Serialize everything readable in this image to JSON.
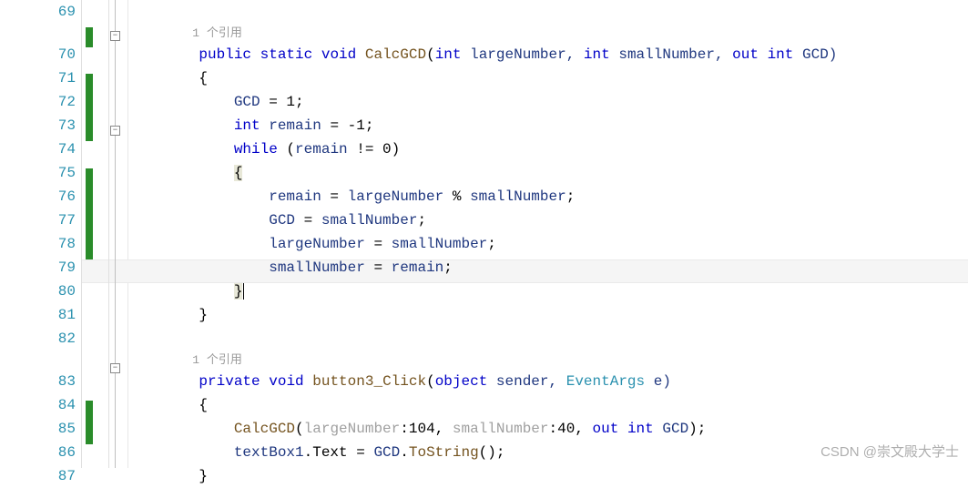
{
  "lines": {
    "start": 69,
    "numbers": [
      "69",
      "70",
      "71",
      "72",
      "73",
      "74",
      "75",
      "76",
      "77",
      "78",
      "79",
      "80",
      "81",
      "82",
      "83",
      "84",
      "85",
      "86",
      "87"
    ]
  },
  "refs": {
    "ref1": "1 个引用",
    "ref2": "1 个引用"
  },
  "code": {
    "l70": {
      "kw1": "public",
      "kw2": "static",
      "kw3": "void",
      "method": "CalcGCD",
      "p": "(",
      "t1": "int",
      "a1": " largeNumber, ",
      "t2": "int",
      "a2": " smallNumber, ",
      "kw4": "out",
      "sp": " ",
      "t3": "int",
      "a3": " GCD)"
    },
    "l71": {
      "t": "{"
    },
    "l72": {
      "v": "GCD",
      "t": " = 1;"
    },
    "l73": {
      "kw": "int",
      "v": " remain",
      "t": " = -1;"
    },
    "l74": {
      "kw": "while",
      "t1": " (",
      "v": "remain",
      "t2": " != 0)"
    },
    "l75": {
      "t": "{"
    },
    "l76": {
      "v1": "remain",
      "t1": " = ",
      "v2": "largeNumber",
      "t2": " % ",
      "v3": "smallNumber",
      "t3": ";"
    },
    "l77": {
      "v1": "GCD",
      "t1": " = ",
      "v2": "smallNumber",
      "t2": ";"
    },
    "l78": {
      "v1": "largeNumber",
      "t1": " = ",
      "v2": "smallNumber",
      "t2": ";"
    },
    "l79": {
      "v1": "smallNumber",
      "t1": " = ",
      "v2": "remain",
      "t2": ";"
    },
    "l80": {
      "t": "}"
    },
    "l81": {
      "t": "}"
    },
    "l83": {
      "kw1": "private",
      "kw2": "void",
      "method": "button3_Click",
      "p": "(",
      "t1": "object",
      "a1": " sender, ",
      "cls": "EventArgs",
      "a2": " e)"
    },
    "l84": {
      "t": "{"
    },
    "l85": {
      "m": "CalcGCD",
      "t1": "(",
      "p1": "largeNumber",
      "c1": ":",
      "n1": "104",
      "t2": ", ",
      "p2": "smallNumber",
      "c2": ":",
      "n2": "40",
      "t3": ", ",
      "kw": "out",
      "sp": " ",
      "ty": "int",
      "v": " GCD",
      "t4": ");"
    },
    "l86": {
      "v1": "textBox1",
      "t1": ".Text = ",
      "v2": "GCD",
      "t2": ".",
      "m": "ToString",
      "t3": "();"
    },
    "l87": {
      "t": "}"
    }
  },
  "watermark": "CSDN @崇文殿大学士"
}
